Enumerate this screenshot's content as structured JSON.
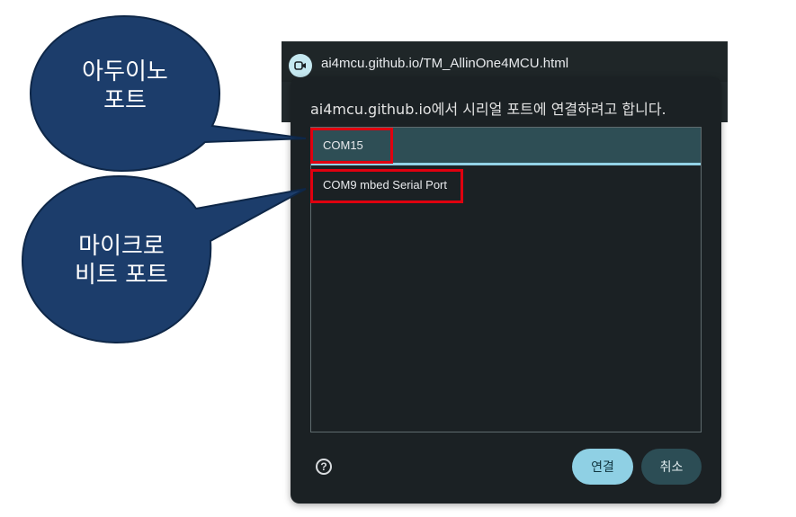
{
  "browser": {
    "url": "ai4mcu.github.io/TM_AllinOne4MCU.html",
    "site_icon": "camera-icon"
  },
  "dialog": {
    "title": "ai4mcu.github.io에서 시리얼 포트에 연결하려고 합니다.",
    "ports": [
      {
        "label": "COM15",
        "selected": true
      },
      {
        "label": "COM9 mbed Serial Port",
        "selected": false
      }
    ],
    "help_icon": "help-icon",
    "connect_label": "연결",
    "cancel_label": "취소"
  },
  "callouts": {
    "arduino_line1": "아두이노",
    "arduino_line2": "포트",
    "microbit_line1": "마이크로",
    "microbit_line2": "비트 포트"
  },
  "colors": {
    "callout_fill": "#1c3d6b",
    "callout_stroke": "#0e2748",
    "highlight": "#e0000f",
    "selected_bg": "#2e4e55",
    "accent": "#8fd0e4"
  }
}
